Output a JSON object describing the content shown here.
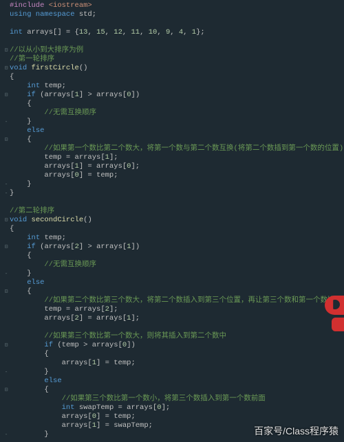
{
  "watermark": "百家号/Class程序猿",
  "code": {
    "lines": [
      {
        "fold": "",
        "tokens": [
          [
            "kw-pre",
            "#include "
          ],
          [
            "str",
            "<iostream>"
          ]
        ]
      },
      {
        "fold": "",
        "tokens": [
          [
            "kw",
            "using namespace "
          ],
          [
            "ident",
            "std"
          ],
          [
            "punc",
            ";"
          ]
        ]
      },
      {
        "fold": "",
        "tokens": []
      },
      {
        "fold": "",
        "tokens": [
          [
            "type",
            "int "
          ],
          [
            "ident",
            "arrays"
          ],
          [
            "punc",
            "[] = {"
          ],
          [
            "num",
            "13"
          ],
          [
            "punc",
            ", "
          ],
          [
            "num",
            "15"
          ],
          [
            "punc",
            ", "
          ],
          [
            "num",
            "12"
          ],
          [
            "punc",
            ", "
          ],
          [
            "num",
            "11"
          ],
          [
            "punc",
            ", "
          ],
          [
            "num",
            "10"
          ],
          [
            "punc",
            ", "
          ],
          [
            "num",
            "9"
          ],
          [
            "punc",
            ", "
          ],
          [
            "num",
            "4"
          ],
          [
            "punc",
            ", "
          ],
          [
            "num",
            "1"
          ],
          [
            "punc",
            "};"
          ]
        ]
      },
      {
        "fold": "",
        "tokens": []
      },
      {
        "fold": "⊟",
        "tokens": [
          [
            "cmt",
            "//以从小到大排序为例"
          ]
        ]
      },
      {
        "fold": "",
        "tokens": [
          [
            "cmt",
            "//第一轮排序"
          ]
        ]
      },
      {
        "fold": "⊟",
        "tokens": [
          [
            "type",
            "void "
          ],
          [
            "fn",
            "firstCircle"
          ],
          [
            "punc",
            "()"
          ]
        ]
      },
      {
        "fold": "",
        "tokens": [
          [
            "punc",
            "{"
          ]
        ]
      },
      {
        "fold": "",
        "tokens": [
          [
            "ident",
            "    "
          ],
          [
            "type",
            "int "
          ],
          [
            "ident",
            "temp"
          ],
          [
            "punc",
            ";"
          ]
        ]
      },
      {
        "fold": "⊟",
        "tokens": [
          [
            "ident",
            "    "
          ],
          [
            "kw",
            "if "
          ],
          [
            "punc",
            "("
          ],
          [
            "ident",
            "arrays"
          ],
          [
            "punc",
            "["
          ],
          [
            "num",
            "1"
          ],
          [
            "punc",
            "] > "
          ],
          [
            "ident",
            "arrays"
          ],
          [
            "punc",
            "["
          ],
          [
            "num",
            "0"
          ],
          [
            "punc",
            "])"
          ]
        ]
      },
      {
        "fold": "",
        "tokens": [
          [
            "punc",
            "    {"
          ]
        ]
      },
      {
        "fold": "",
        "tokens": [
          [
            "ident",
            "        "
          ],
          [
            "cmt",
            "//无需互换顺序"
          ]
        ]
      },
      {
        "fold": "-",
        "tokens": [
          [
            "punc",
            "    }"
          ]
        ]
      },
      {
        "fold": "",
        "tokens": [
          [
            "ident",
            "    "
          ],
          [
            "kw",
            "else"
          ]
        ]
      },
      {
        "fold": "⊟",
        "tokens": [
          [
            "punc",
            "    {"
          ]
        ]
      },
      {
        "fold": "",
        "tokens": [
          [
            "ident",
            "        "
          ],
          [
            "cmt",
            "//如果第一个数比第二个数大，将第一个数与第二个数互换(将第二个数插到第一个数的位置)"
          ]
        ]
      },
      {
        "fold": "",
        "tokens": [
          [
            "ident",
            "        temp = arrays["
          ],
          [
            "num",
            "1"
          ],
          [
            "punc",
            "];"
          ]
        ]
      },
      {
        "fold": "",
        "tokens": [
          [
            "ident",
            "        arrays["
          ],
          [
            "num",
            "1"
          ],
          [
            "ident",
            "] = arrays["
          ],
          [
            "num",
            "0"
          ],
          [
            "punc",
            "];"
          ]
        ]
      },
      {
        "fold": "",
        "tokens": [
          [
            "ident",
            "        arrays["
          ],
          [
            "num",
            "0"
          ],
          [
            "ident",
            "] = temp"
          ],
          [
            "punc",
            ";"
          ]
        ]
      },
      {
        "fold": "-",
        "tokens": [
          [
            "punc",
            "    }"
          ]
        ]
      },
      {
        "fold": "-",
        "tokens": [
          [
            "punc",
            "}"
          ]
        ]
      },
      {
        "fold": "",
        "tokens": []
      },
      {
        "fold": "",
        "tokens": [
          [
            "cmt",
            "//第二轮排序"
          ]
        ]
      },
      {
        "fold": "⊟",
        "tokens": [
          [
            "type",
            "void "
          ],
          [
            "fn",
            "secondCircle"
          ],
          [
            "punc",
            "()"
          ]
        ]
      },
      {
        "fold": "",
        "tokens": [
          [
            "punc",
            "{"
          ]
        ]
      },
      {
        "fold": "",
        "tokens": [
          [
            "ident",
            "    "
          ],
          [
            "type",
            "int "
          ],
          [
            "ident",
            "temp"
          ],
          [
            "punc",
            ";"
          ]
        ]
      },
      {
        "fold": "⊟",
        "tokens": [
          [
            "ident",
            "    "
          ],
          [
            "kw",
            "if "
          ],
          [
            "punc",
            "("
          ],
          [
            "ident",
            "arrays"
          ],
          [
            "punc",
            "["
          ],
          [
            "num",
            "2"
          ],
          [
            "punc",
            "] > "
          ],
          [
            "ident",
            "arrays"
          ],
          [
            "punc",
            "["
          ],
          [
            "num",
            "1"
          ],
          [
            "punc",
            "])"
          ]
        ]
      },
      {
        "fold": "",
        "tokens": [
          [
            "punc",
            "    {"
          ]
        ]
      },
      {
        "fold": "",
        "tokens": [
          [
            "ident",
            "        "
          ],
          [
            "cmt",
            "//无需互换顺序"
          ]
        ]
      },
      {
        "fold": "-",
        "tokens": [
          [
            "punc",
            "    }"
          ]
        ]
      },
      {
        "fold": "",
        "tokens": [
          [
            "ident",
            "    "
          ],
          [
            "kw",
            "else"
          ]
        ]
      },
      {
        "fold": "⊟",
        "tokens": [
          [
            "punc",
            "    {"
          ]
        ]
      },
      {
        "fold": "",
        "tokens": [
          [
            "ident",
            "        "
          ],
          [
            "cmt",
            "//如果第二个数比第三个数大，将第二个数插入到第三个位置，再让第三个数和第一个数比较"
          ]
        ]
      },
      {
        "fold": "",
        "tokens": [
          [
            "ident",
            "        temp = arrays["
          ],
          [
            "num",
            "2"
          ],
          [
            "punc",
            "];"
          ]
        ]
      },
      {
        "fold": "",
        "tokens": [
          [
            "ident",
            "        arrays["
          ],
          [
            "num",
            "2"
          ],
          [
            "ident",
            "] = arrays["
          ],
          [
            "num",
            "1"
          ],
          [
            "punc",
            "];"
          ]
        ]
      },
      {
        "fold": "",
        "tokens": []
      },
      {
        "fold": "",
        "tokens": [
          [
            "ident",
            "        "
          ],
          [
            "cmt",
            "//如果第三个数比第一个数大，则将其插入到第二个数中"
          ]
        ]
      },
      {
        "fold": "⊟",
        "tokens": [
          [
            "ident",
            "        "
          ],
          [
            "kw",
            "if "
          ],
          [
            "punc",
            "("
          ],
          [
            "ident",
            "temp > arrays"
          ],
          [
            "punc",
            "["
          ],
          [
            "num",
            "0"
          ],
          [
            "punc",
            "])"
          ]
        ]
      },
      {
        "fold": "",
        "tokens": [
          [
            "punc",
            "        {"
          ]
        ]
      },
      {
        "fold": "",
        "tokens": [
          [
            "ident",
            "            arrays["
          ],
          [
            "num",
            "1"
          ],
          [
            "ident",
            "] = temp"
          ],
          [
            "punc",
            ";"
          ]
        ]
      },
      {
        "fold": "-",
        "tokens": [
          [
            "punc",
            "        }"
          ]
        ]
      },
      {
        "fold": "",
        "tokens": [
          [
            "ident",
            "        "
          ],
          [
            "kw",
            "else"
          ]
        ]
      },
      {
        "fold": "⊟",
        "tokens": [
          [
            "punc",
            "        {"
          ]
        ]
      },
      {
        "fold": "",
        "tokens": [
          [
            "ident",
            "            "
          ],
          [
            "cmt",
            "//如果第三个数比第一个数小，将第三个数插入到第一个数前面"
          ]
        ]
      },
      {
        "fold": "",
        "tokens": [
          [
            "ident",
            "            "
          ],
          [
            "type",
            "int "
          ],
          [
            "ident",
            "swapTemp = arrays["
          ],
          [
            "num",
            "0"
          ],
          [
            "punc",
            "];"
          ]
        ]
      },
      {
        "fold": "",
        "tokens": [
          [
            "ident",
            "            arrays["
          ],
          [
            "num",
            "0"
          ],
          [
            "ident",
            "] = temp"
          ],
          [
            "punc",
            ";"
          ]
        ]
      },
      {
        "fold": "",
        "tokens": [
          [
            "ident",
            "            arrays["
          ],
          [
            "num",
            "1"
          ],
          [
            "ident",
            "] = swapTemp"
          ],
          [
            "punc",
            ";"
          ]
        ]
      },
      {
        "fold": "-",
        "tokens": [
          [
            "punc",
            "        }"
          ]
        ]
      }
    ]
  }
}
